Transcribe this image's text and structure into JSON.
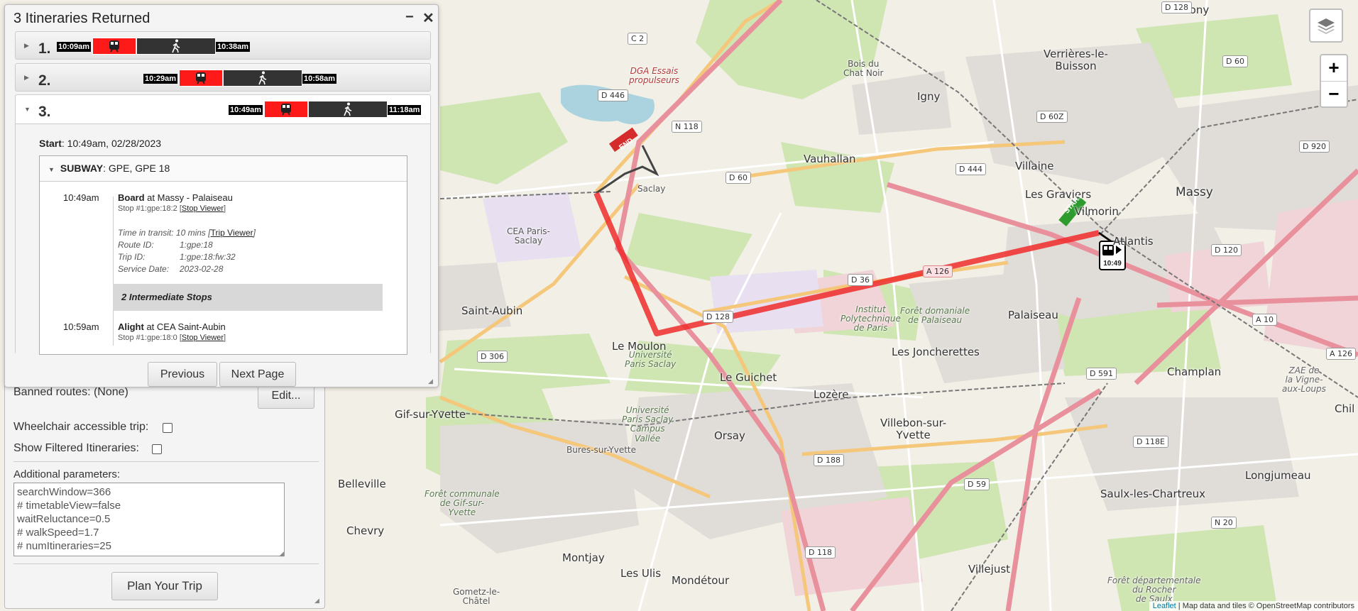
{
  "itineraries_panel": {
    "title": "3 Itineraries Returned",
    "minimize_glyph": "−",
    "close_glyph": "✕",
    "itineraries": [
      {
        "num": "1.",
        "start": "10:09am",
        "end": "10:38am",
        "expanded": false
      },
      {
        "num": "2.",
        "start": "10:29am",
        "end": "10:58am",
        "expanded": false
      },
      {
        "num": "3.",
        "start": "10:49am",
        "end": "11:18am",
        "expanded": true
      }
    ],
    "detail": {
      "start_label": "Start",
      "start_value": ": 10:49am, 02/28/2023",
      "leg_mode": "SUBWAY",
      "leg_routes": ": GPE, GPE 18",
      "board": {
        "time": "10:49am",
        "action": "Board",
        "at": " at Massy - Palaiseau",
        "stop_id": "Stop #1:gpe:18:2 [",
        "stop_link": "Stop Viewer",
        "close": "]"
      },
      "transit": {
        "label": "Time in transit: 10 mins [",
        "link": "Trip Viewer",
        "close": "]",
        "route_k": "Route ID:",
        "route_v": "1:gpe:18",
        "trip_k": "Trip ID:",
        "trip_v": "1:gpe:18:fw:32",
        "date_k": "Service Date:",
        "date_v": "2023-02-28"
      },
      "intermediate": "2 Intermediate Stops",
      "alight": {
        "time": "10:59am",
        "action": "Alight",
        "at": " at CEA Saint-Aubin",
        "stop_id": "Stop #1:gpe:18:0 [",
        "stop_link": "Stop Viewer",
        "close": "]"
      }
    },
    "previous_label": "Previous",
    "next_label": "Next Page"
  },
  "options_panel": {
    "banned_routes": "Banned routes: (None)",
    "edit_label": "Edit...",
    "wheelchair_label": "Wheelchair accessible trip:",
    "wheelchair_checked": false,
    "filtered_label": "Show Filtered Itineraries:",
    "filtered_checked": false,
    "additional_label": "Additional parameters:",
    "additional_value": "searchWindow=366\n# timetableView=false\nwaitReluctance=0.5\n# walkSpeed=1.7\n# numItineraries=25",
    "plan_label": "Plan Your Trip"
  },
  "map": {
    "zoom_in": "+",
    "zoom_out": "−",
    "layers_icon": "layers-icon",
    "attribution_link": "Leaflet",
    "attribution_text": " | Map data and tiles © OpenStreetMap contributors",
    "start_marker": "START",
    "end_marker": "END",
    "vehicle_time": "10:49",
    "route_color": "#ee2b2b",
    "places": {
      "p1": "Verrières-le-\nBuisson",
      "p2": "Antony",
      "p3": "Igny",
      "p4": "Bois du\nChat Noir",
      "p5": "Vauhallan",
      "p6": "Saclay",
      "p7": "DGA Essais\npropulseurs",
      "p8": "CEA Paris-\nSaclay",
      "p9": "Saint-Aubin",
      "p10": "Le Moulon",
      "p11": "Université\nParis Saclay",
      "p12": "Le Guichet",
      "p13": "Lozère",
      "p14": "Palaiseau",
      "p15": "Institut\nPolytechnique\nde Paris",
      "p16": "Forêt domaniale\nde Palaiseau",
      "p17": "Les Joncherettes",
      "p18": "Villaine",
      "p19": "Les Graviers",
      "p20": "Vilmorin",
      "p21": "Atlantis",
      "p22": "Massy",
      "p23": "Champlan",
      "p24": "ZAE de\nla Vigne-\naux-Loups",
      "p25": "Gif-sur-Yvette",
      "p26": "Bures-sur-Yvette",
      "p27": "Orsay",
      "p28": "Villebon-sur-\nYvette",
      "p29": "Université\nParis Saclay\nCampus\nVallée",
      "p30": "Belleville",
      "p31": "Chevry",
      "p32": "Forêt communale\nde Gif-sur-\nYvette",
      "p33": "Montjay",
      "p34": "Les Ulis",
      "p35": "Mondétour",
      "p36": "Gometz-le-\nChâtel",
      "p37": "Villejust",
      "p38": "Saulx-les-Chartreux",
      "p39": "Longjumeau",
      "p40": "Forêt départementale\ndu Rocher\nde Saulx",
      "p41": "Chil"
    },
    "shields": {
      "s1": "C 2",
      "s2": "D 446",
      "s3": "N 118",
      "s4": "D 60",
      "s5": "D 444",
      "s6": "D 60Z",
      "s7": "D 60",
      "s8": "D 128",
      "s9": "D 920",
      "s10": "D 36",
      "s11": "D 128",
      "s12": "D 306",
      "s13": "D 120",
      "s14": "A 10",
      "s15": "A 126",
      "s16": "D 591",
      "s17": "D 118E",
      "s18": "D 188",
      "s19": "D 59",
      "s20": "D 118",
      "s21": "N 20",
      "s22": "A 126"
    }
  }
}
